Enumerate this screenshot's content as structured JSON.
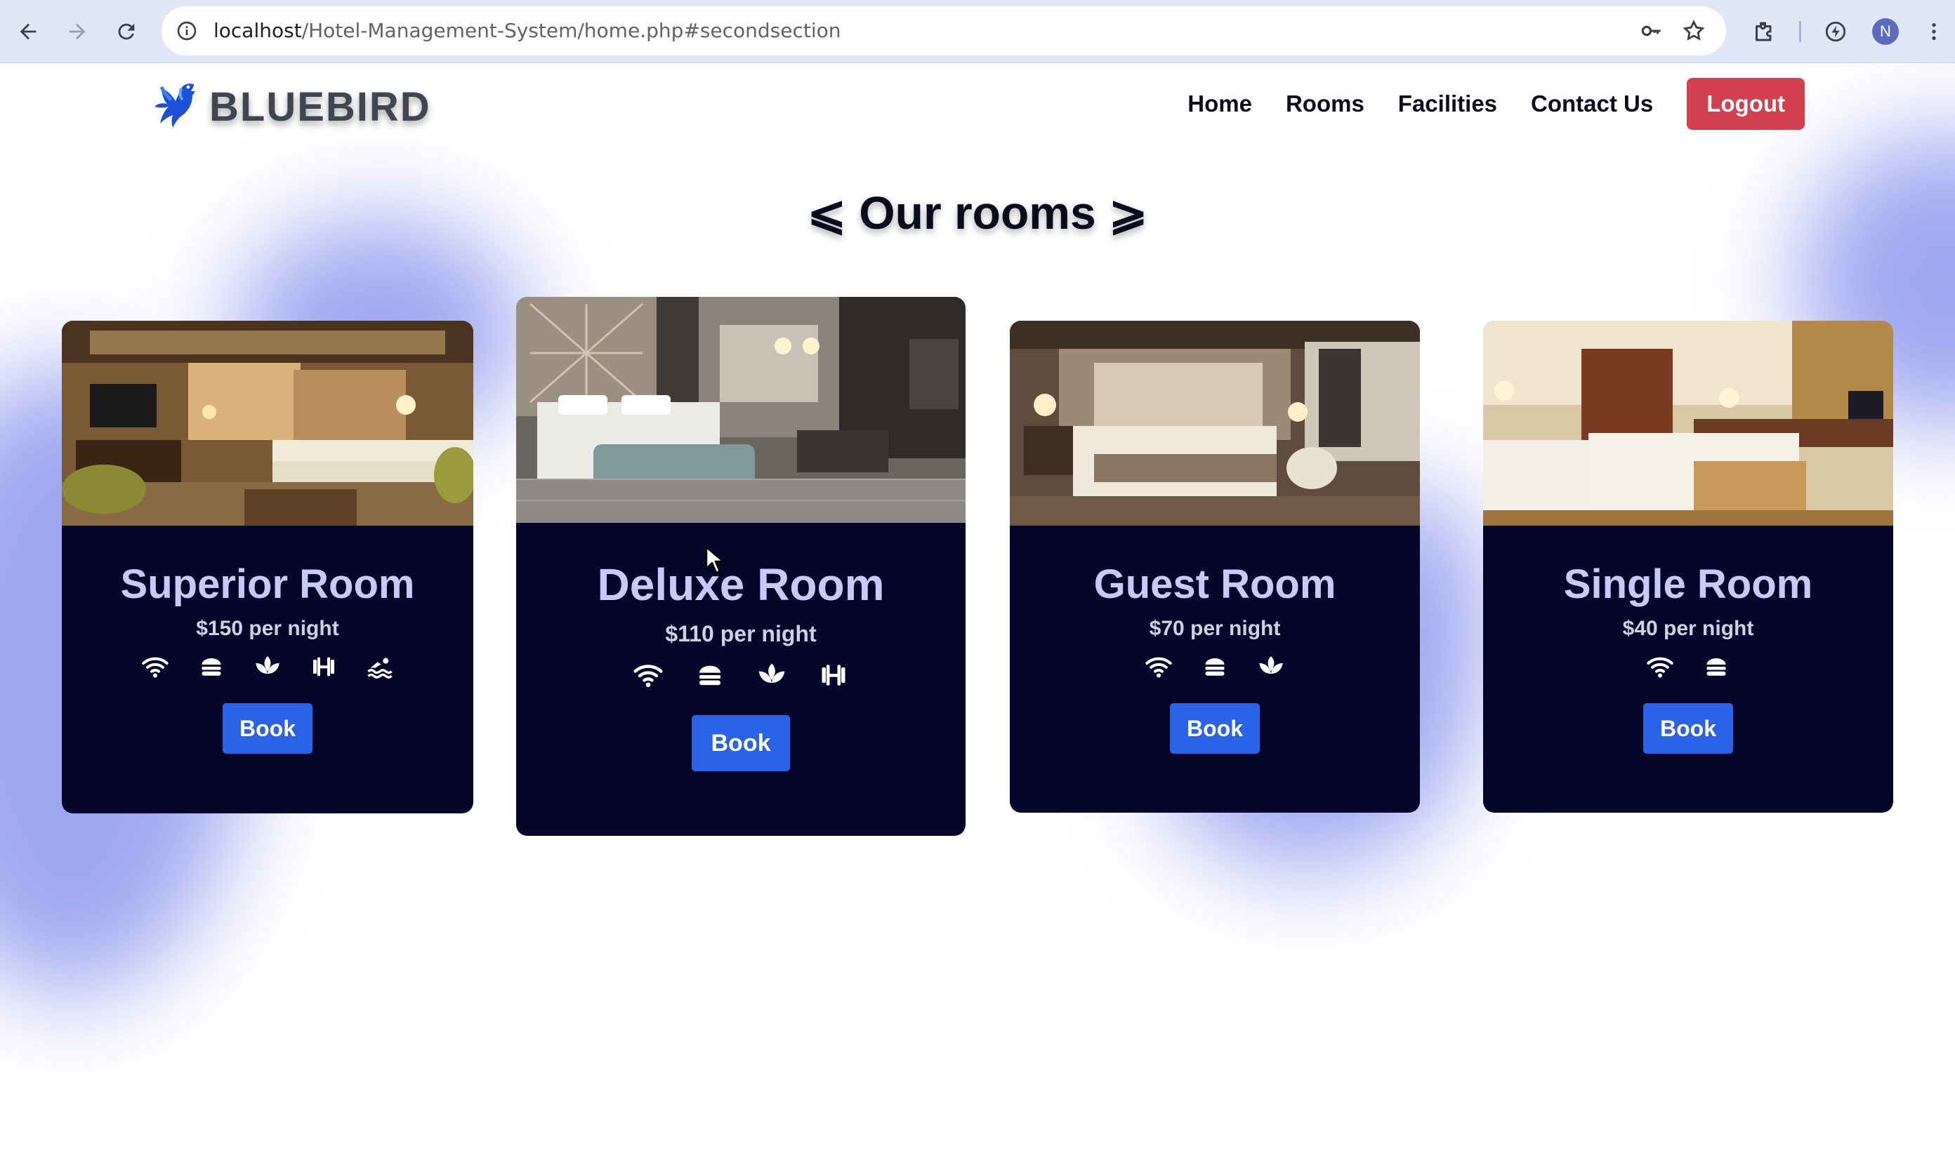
{
  "browser": {
    "url_host": "localhost",
    "url_path": "/Hotel-Management-System/home.php#secondsection",
    "profile_initial": "N",
    "icons": [
      "back-icon",
      "forward-icon",
      "reload-icon",
      "site-info-icon",
      "password-key-icon",
      "bookmark-star-icon",
      "extensions-icon",
      "performance-icon",
      "menu-kebab-icon"
    ]
  },
  "header": {
    "logo_text": "BLUEBIRD",
    "nav": [
      "Home",
      "Rooms",
      "Facilities",
      "Contact Us"
    ],
    "logout_label": "Logout"
  },
  "section": {
    "title": "⩽ Our rooms ⩾"
  },
  "rooms": [
    {
      "name": "Superior Room",
      "price": "$150 per night",
      "amenities": [
        "wifi",
        "burger",
        "spa",
        "dumbbell",
        "swimmer"
      ],
      "button": "Book"
    },
    {
      "name": "Deluxe Room",
      "price": "$110 per night",
      "amenities": [
        "wifi",
        "burger",
        "spa",
        "dumbbell"
      ],
      "button": "Book"
    },
    {
      "name": "Guest Room",
      "price": "$70 per night",
      "amenities": [
        "wifi",
        "burger",
        "spa"
      ],
      "button": "Book"
    },
    {
      "name": "Single Room",
      "price": "$40 per night",
      "amenities": [
        "wifi",
        "burger"
      ],
      "button": "Book"
    }
  ],
  "colors": {
    "card_bg": "#06052a",
    "title": "#c9c9f8",
    "book_button": "#2b63e8",
    "logout_button": "#d3404f",
    "blob": "#8f98ee"
  }
}
